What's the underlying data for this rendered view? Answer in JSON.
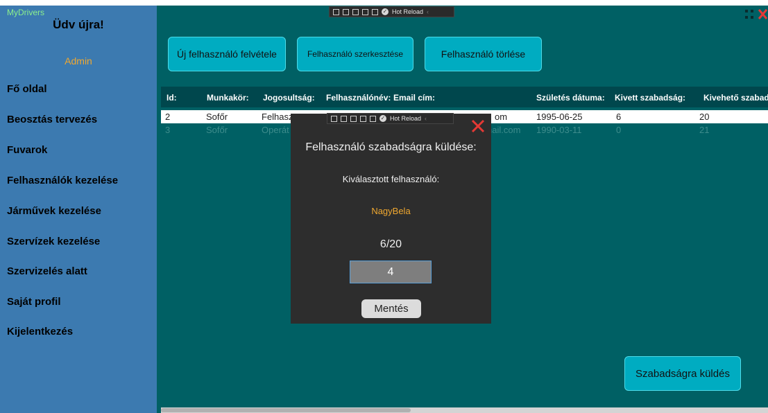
{
  "sidebar": {
    "app_name": "MyDrivers",
    "welcome": "Üdv újra!",
    "user_role": "Admin",
    "items": [
      {
        "label": "Fő oldal"
      },
      {
        "label": "Beosztás tervezés"
      },
      {
        "label": "Fuvarok"
      },
      {
        "label": "Felhasználók kezelése"
      },
      {
        "label": "Járművek kezelése"
      },
      {
        "label": "Szervízek kezelése"
      },
      {
        "label": "Szervizelés alatt"
      },
      {
        "label": "Saját profil"
      },
      {
        "label": "Kijelentkezés"
      }
    ]
  },
  "devtools": {
    "hot_reload": "Hot Reload"
  },
  "toolbar": {
    "add_user": "Új felhasználó felvétele",
    "edit_user": "Felhasználó szerkesztése",
    "delete_user": "Felhasználó törlése"
  },
  "table": {
    "columns": [
      "Id:",
      "Munkakör:",
      "Jogosultság:",
      "Felhasználónév:",
      "Email cím:",
      "Születés dátuma:",
      "Kivett szabadság:",
      "Kivehető szabad"
    ],
    "rows": [
      {
        "id": "2",
        "job": "Sofőr",
        "perm": "Felhasz",
        "email": "om",
        "birth": "1995-06-25",
        "taken": "6",
        "avail": "20"
      },
      {
        "id": "3",
        "job": "Sofőr",
        "perm": "Operát",
        "email": "nail.com",
        "birth": "1990-03-11",
        "taken": "0",
        "avail": "21"
      }
    ]
  },
  "send_vacation_button": "Szabadságra küldés",
  "dialog": {
    "title": "Felhasználó szabadságra küldése:",
    "selected_label": "Kiválasztott felhasználó:",
    "username": "NagyBela",
    "ratio": "6/20",
    "days_value": "4",
    "save_label": "Mentés"
  },
  "colors": {
    "background": "#006064",
    "sidebar": "#3c7ab0",
    "button": "#00acc1",
    "accent_orange": "#f0a830",
    "dialog_bg": "#2d2d2d",
    "close_red": "#e53935"
  }
}
